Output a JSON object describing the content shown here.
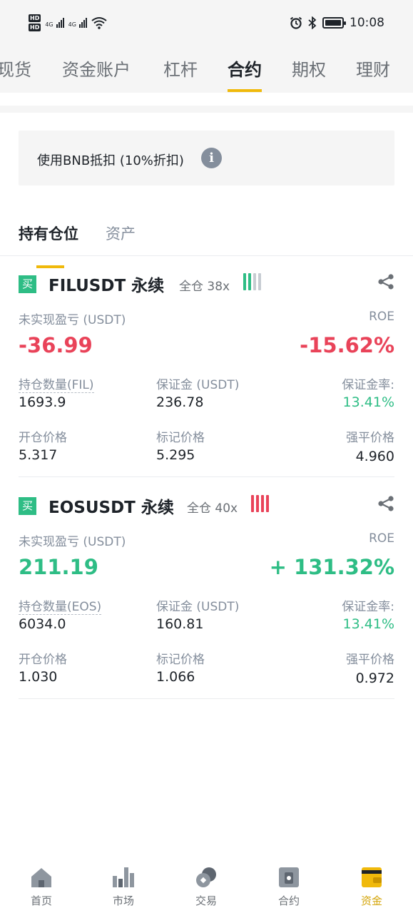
{
  "status_bar": {
    "network1": "4G",
    "network2": "4G",
    "time": "10:08"
  },
  "top_tabs": [
    {
      "label": "现货",
      "active": false
    },
    {
      "label": "资金账户",
      "active": false
    },
    {
      "label": "杠杆",
      "active": false
    },
    {
      "label": "合约",
      "active": true
    },
    {
      "label": "期权",
      "active": false
    },
    {
      "label": "理财",
      "active": false
    }
  ],
  "bnb_discount": {
    "label": "使用BNB抵扣 (10%折扣)",
    "icon": "info-icon"
  },
  "sub_tabs": [
    {
      "label": "持有仓位",
      "active": true
    },
    {
      "label": "资产",
      "active": false
    }
  ],
  "positions": [
    {
      "side": "买",
      "symbol": "FILUSDT 永续",
      "margin_mode": "全仓 38x",
      "risk_colors": [
        "#2ebd85",
        "#2ebd85",
        "#c7ccd2",
        "#c7ccd2"
      ],
      "pnl_label": "未实现盈亏 (USDT)",
      "pnl": "-36.99",
      "pnl_sign": "negative",
      "roe_label": "ROE",
      "roe": "-15.62%",
      "size_label": "持仓数量(FIL)",
      "size": "1693.9",
      "margin_label": "保证金 (USDT)",
      "margin": "236.78",
      "margin_ratio_label": "保证金率:",
      "margin_ratio": "13.41%",
      "entry_label": "开仓价格",
      "entry_price": "5.317",
      "mark_label": "标记价格",
      "mark_price": "5.295",
      "liq_label": "强平价格",
      "liq_price": "4.960"
    },
    {
      "side": "买",
      "symbol": "EOSUSDT 永续",
      "margin_mode": "全仓 40x",
      "risk_colors": [
        "#e94359",
        "#e94359",
        "#e94359",
        "#e94359"
      ],
      "pnl_label": "未实现盈亏 (USDT)",
      "pnl": "211.19",
      "pnl_sign": "positive",
      "roe_label": "ROE",
      "roe": "+ 131.32%",
      "size_label": "持仓数量(EOS)",
      "size": "6034.0",
      "margin_label": "保证金 (USDT)",
      "margin": "160.81",
      "margin_ratio_label": "保证金率:",
      "margin_ratio": "13.41%",
      "entry_label": "开仓价格",
      "entry_price": "1.030",
      "mark_label": "标记价格",
      "mark_price": "1.066",
      "liq_label": "强平价格",
      "liq_price": "0.972"
    }
  ],
  "bottom_nav": [
    {
      "label": "首页",
      "icon": "home-icon",
      "active": false
    },
    {
      "label": "市场",
      "icon": "market-icon",
      "active": false
    },
    {
      "label": "交易",
      "icon": "trade-icon",
      "active": false
    },
    {
      "label": "合约",
      "icon": "futures-icon",
      "active": false
    },
    {
      "label": "资金",
      "icon": "wallet-icon",
      "active": true
    }
  ],
  "colors": {
    "accent": "#f0b90b",
    "positive": "#2ebd85",
    "negative": "#e94359"
  }
}
